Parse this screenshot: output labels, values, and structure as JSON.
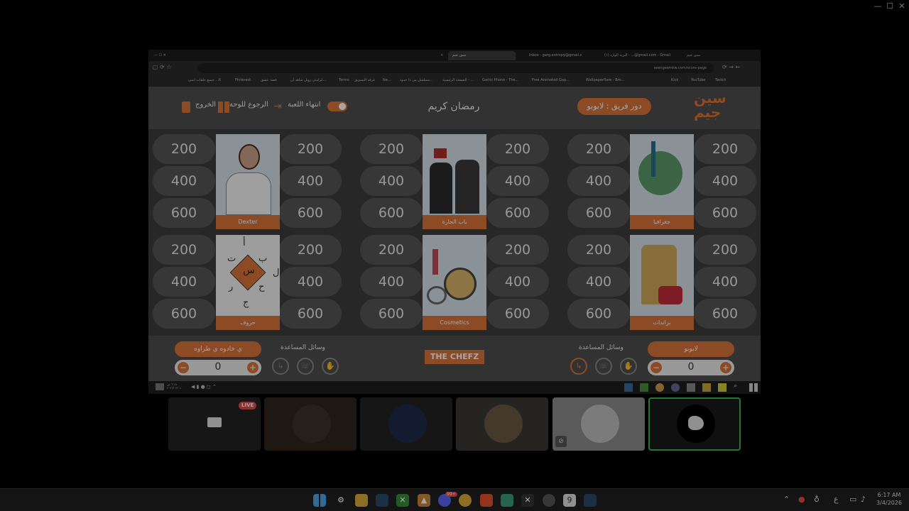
{
  "outer_window": {
    "minimize": "—",
    "maximize": "☐",
    "close": "✕"
  },
  "browser": {
    "tabs": [
      {
        "label": "سين جيم",
        "active": false
      },
      {
        "label": "البريد الوارد (١) - ...@gmail.com - Gmail",
        "active": false
      },
      {
        "label": "Inbox - garg.entropy@gmail.c",
        "active": false
      },
      {
        "label": "سين جيم",
        "active": true
      }
    ],
    "url": "seengeemkw.com/score-page",
    "bookmarks": [
      "Twitch",
      "YouTube",
      "Kick",
      "Wallpaperflare - Bro...",
      "Free Animated Gop...",
      "Gartic Phone - The...",
      "الصفحة الرئيسية - ...",
      "مسلسل من ذا حدود...",
      "Ne...",
      "غرفة التسويق",
      "Terms",
      "كرامتي زوبل شاهد أن...",
      "قصة عشق",
      "Pinterest",
      "جميع حلقات انمي ...K"
    ]
  },
  "game": {
    "logo_line1": "سين",
    "logo_line2": "جيم",
    "turn_label": "دور فريق : لابوبو",
    "title": "رمضان كريم",
    "end_game": "انتهاء اللعبة",
    "back_to_board": "الرجوع للوحة",
    "exit": "الخروج",
    "categories": [
      {
        "name": "جغرافيا",
        "values": [
          "200",
          "400",
          "600"
        ]
      },
      {
        "name": "باب الحارة",
        "values": [
          "200",
          "400",
          "600"
        ]
      },
      {
        "name": "Dexter",
        "values": [
          "200",
          "400",
          "600"
        ]
      },
      {
        "name": "براندات",
        "values": [
          "200",
          "400",
          "600"
        ]
      },
      {
        "name": "Cosmetics",
        "values": [
          "200",
          "400",
          "600"
        ]
      },
      {
        "name": "حروف",
        "values": [
          "200",
          "400",
          "600"
        ]
      }
    ],
    "letters_grid": [
      "أ",
      "ب",
      "ت",
      "ل",
      "س",
      "ح",
      "ر",
      "ج"
    ],
    "footer": {
      "team_right": {
        "name": "لابوبو",
        "score": "0",
        "lifelines_label": "وسائل المساعدة"
      },
      "team_left": {
        "name": "ي خادوه ي طراوه",
        "score": "0",
        "lifelines_label": "وسائل المساعدة"
      },
      "brand": "THE CHEFZ"
    },
    "screen_clock": "٦:١٨ ص\n٢٠٢٦/٠٣/٠٤"
  },
  "participants": [
    {
      "type": "screen-share",
      "badge": "LIVE"
    },
    {
      "type": "camera"
    },
    {
      "type": "camera"
    },
    {
      "type": "camera"
    },
    {
      "type": "camera",
      "muted": true
    },
    {
      "type": "camera",
      "active": true
    }
  ],
  "taskbar": {
    "time": "6:17 AM",
    "date": "3/4/2026",
    "lang": "ع",
    "badge": "99+"
  },
  "colors": {
    "accent": "#d9733a",
    "screen_bg": "#3c3c3c"
  }
}
